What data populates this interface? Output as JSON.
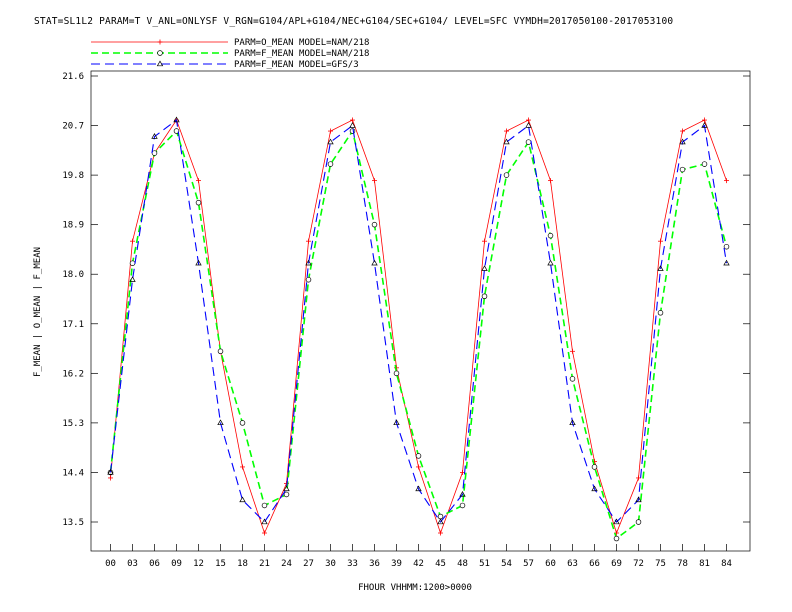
{
  "title": "STAT=SL1L2 PARAM=T V_ANL=ONLYSF V_RGN=G104/APL+G104/NEC+G104/SEC+G104/ LEVEL=SFC VYMDH=2017050100-2017053100",
  "chart_data": {
    "type": "line",
    "xlabel": "FHOUR VHHMM:1200>0000",
    "ylabel": "F_MEAN | O_MEAN | F_MEAN",
    "ylim": [
      13.5,
      21.6
    ],
    "yticks": [
      "13.5",
      "14.4",
      "15.3",
      "16.2",
      "17.1",
      "18.0",
      "18.9",
      "19.8",
      "20.7",
      "21.6"
    ],
    "categories": [
      "00",
      "03",
      "06",
      "09",
      "12",
      "15",
      "18",
      "21",
      "24",
      "27",
      "30",
      "33",
      "36",
      "39",
      "42",
      "45",
      "48",
      "51",
      "54",
      "57",
      "60",
      "63",
      "66",
      "69",
      "72",
      "75",
      "78",
      "81",
      "84"
    ],
    "grid": false,
    "legend_position": "top-left",
    "series": [
      {
        "name": "PARM=O_MEAN MODEL=NAM/218",
        "color": "#ff0000",
        "dash": "solid",
        "marker": "plus",
        "values": [
          14.3,
          18.6,
          20.2,
          20.8,
          19.7,
          16.6,
          14.5,
          13.3,
          14.2,
          18.6,
          20.6,
          20.8,
          19.7,
          16.3,
          14.5,
          13.3,
          14.4,
          18.6,
          20.6,
          20.8,
          19.7,
          16.6,
          14.6,
          13.3,
          14.3,
          18.6,
          20.6,
          20.8,
          19.7
        ]
      },
      {
        "name": "PARM=F_MEAN MODEL=NAM/218",
        "color": "#00ff00",
        "dash": "dashed",
        "marker": "circle",
        "values": [
          14.4,
          18.2,
          20.2,
          20.6,
          19.3,
          16.6,
          15.3,
          13.8,
          14.0,
          17.9,
          20.0,
          20.6,
          18.9,
          16.2,
          14.7,
          13.6,
          13.8,
          17.6,
          19.8,
          20.4,
          18.7,
          16.1,
          14.5,
          13.2,
          13.5,
          17.3,
          19.9,
          20.0,
          18.5
        ]
      },
      {
        "name": "PARM=F_MEAN MODEL=GFS/3",
        "color": "#0000ff",
        "dash": "dashed",
        "marker": "triangle",
        "values": [
          14.4,
          17.9,
          20.5,
          20.8,
          18.2,
          15.3,
          13.9,
          13.5,
          14.1,
          18.2,
          20.4,
          20.7,
          18.2,
          15.3,
          14.1,
          13.5,
          14.0,
          18.1,
          20.4,
          20.7,
          18.2,
          15.3,
          14.1,
          13.5,
          13.9,
          18.1,
          20.4,
          20.7,
          18.2
        ]
      }
    ]
  }
}
